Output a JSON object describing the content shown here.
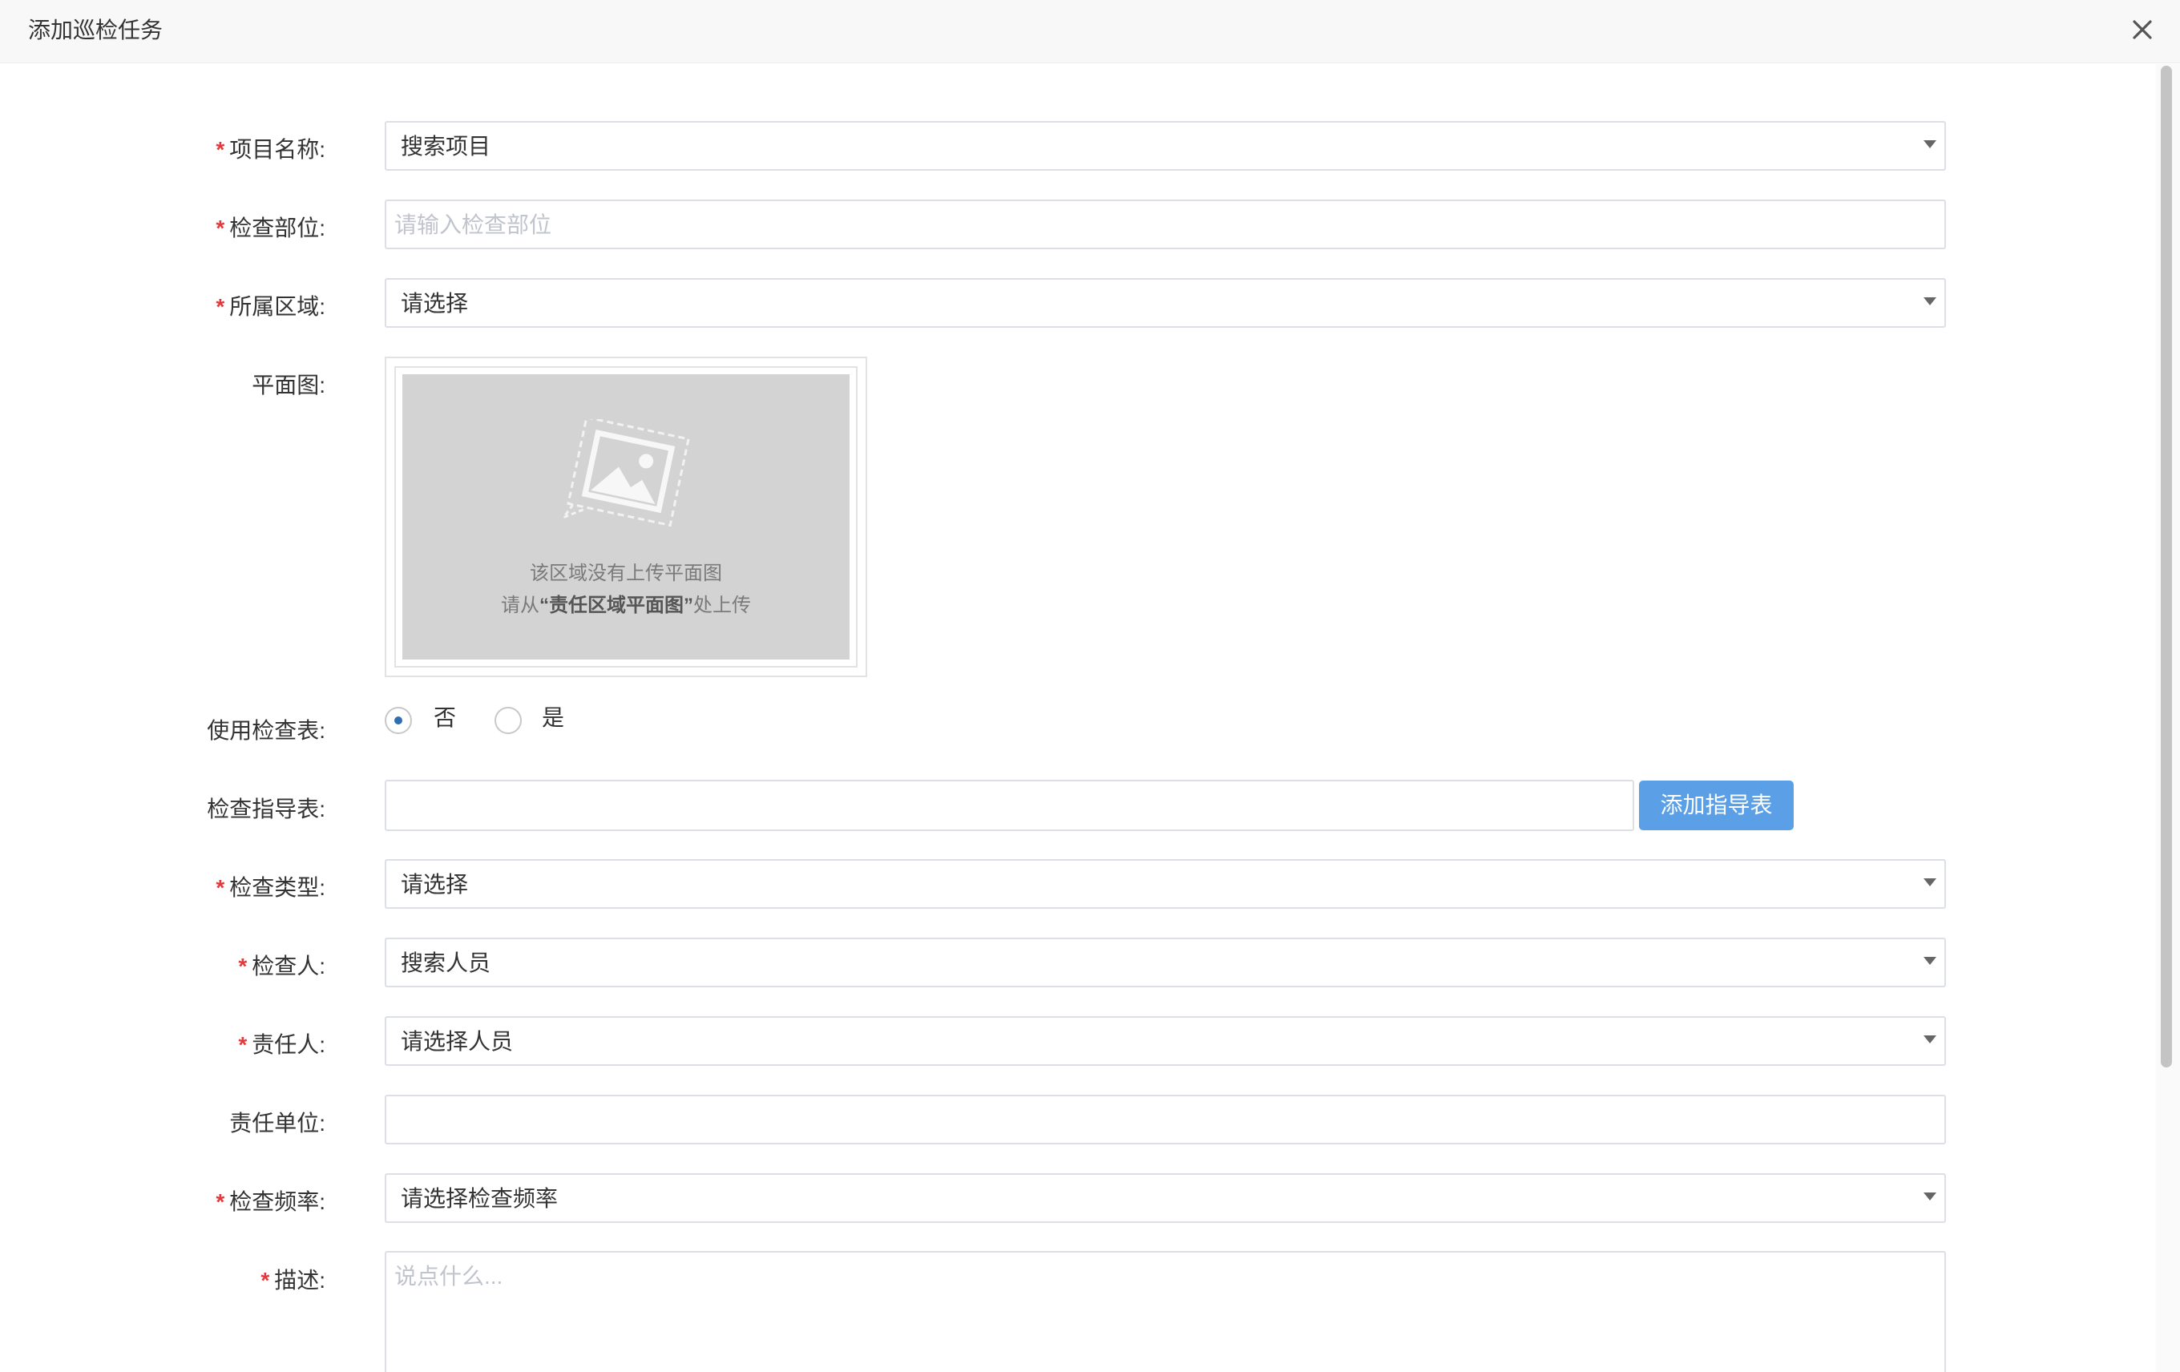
{
  "dialog": {
    "title": "添加巡检任务"
  },
  "form": {
    "project": {
      "label": "项目名称:",
      "value": "搜索项目"
    },
    "check_location": {
      "label": "检查部位:",
      "placeholder": "请输入检查部位"
    },
    "area": {
      "label": "所属区域:",
      "value": "请选择"
    },
    "floor_plan": {
      "label": "平面图:",
      "empty_line1": "该区域没有上传平面图",
      "empty_line2_prefix": "请从",
      "empty_line2_link": "“责任区域平面图”",
      "empty_line2_suffix": "处上传"
    },
    "use_checklist": {
      "label": "使用检查表:",
      "options": [
        "否",
        "是"
      ],
      "selected": "否"
    },
    "guide_table": {
      "label": "检查指导表:",
      "value": "",
      "button_label": "添加指导表"
    },
    "check_type": {
      "label": "检查类型:",
      "value": "请选择"
    },
    "inspector": {
      "label": "检查人:",
      "value": "搜索人员"
    },
    "responsible_person": {
      "label": "责任人:",
      "value": "请选择人员"
    },
    "responsible_unit": {
      "label": "责任单位:",
      "value": ""
    },
    "frequency": {
      "label": "检查频率:",
      "value": "请选择检查频率"
    },
    "description": {
      "label": "描述:",
      "placeholder": "说点什么..."
    }
  },
  "required_mark": "*",
  "colors": {
    "accent": "#5ba0e6",
    "required": "#e4393c",
    "radio_checked": "#2d6fb0"
  }
}
